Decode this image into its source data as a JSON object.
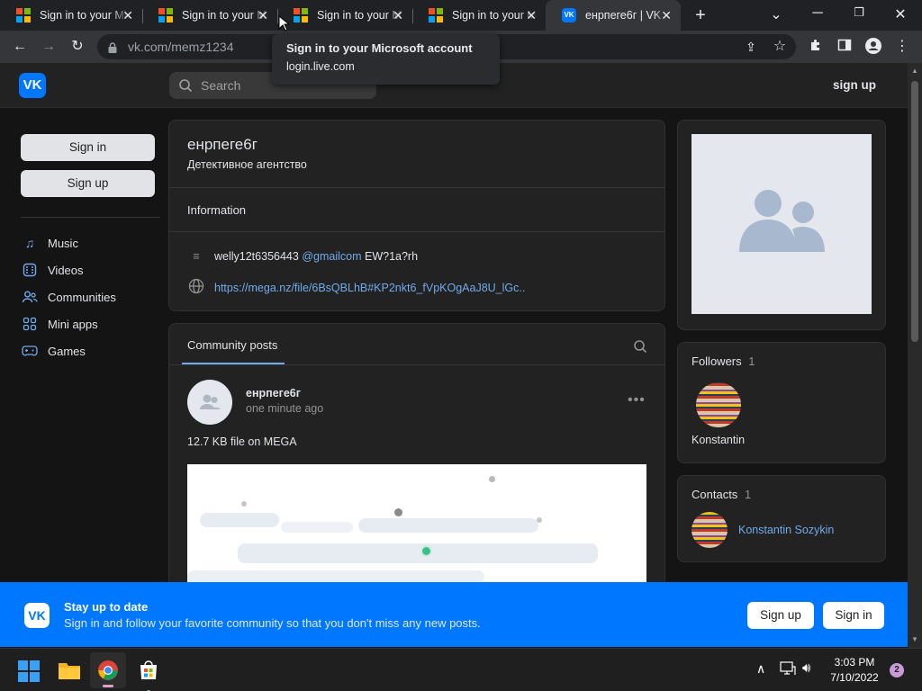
{
  "browser": {
    "tabs": [
      {
        "label": "Sign in to your Microsoft account"
      },
      {
        "label": "Sign in to your Microsoft account"
      },
      {
        "label": "Sign in to your Microsoft account"
      },
      {
        "label": "Sign in to your Microsoft account"
      },
      {
        "label": "енрпеге6г | VK"
      }
    ],
    "url": "vk.com/memz1234",
    "tooltip": {
      "title": "Sign in to your Microsoft account",
      "host": "login.live.com"
    }
  },
  "vk": {
    "search_placeholder": "Search",
    "header_signup": "sign up",
    "sign_in": "Sign in",
    "sign_up": "Sign up",
    "nav": [
      {
        "label": "Music",
        "icon": "music-icon"
      },
      {
        "label": "Videos",
        "icon": "videos-icon"
      },
      {
        "label": "Communities",
        "icon": "communities-icon"
      },
      {
        "label": "Mini apps",
        "icon": "mini-apps-icon"
      },
      {
        "label": "Games",
        "icon": "games-icon"
      }
    ],
    "profile": {
      "name": "енрпеге6г",
      "status": "Детективное агентство",
      "info_heading": "Information",
      "info_text_1": "welly12t6356443",
      "info_text_2": "@gmailcom",
      "info_text_3": "EW?1a?rh",
      "info_link": "https://mega.nz/file/6BsQBLhB#KP2nkt6_fVpKOgAaJ8U_lGc.."
    },
    "posts": {
      "tab_label": "Community posts",
      "author": "енрпеге6г",
      "time": "one minute ago",
      "text": "12.7 KB file on MEGA"
    },
    "followers": {
      "label": "Followers",
      "count": "1",
      "name": "Konstantin"
    },
    "contacts": {
      "label": "Contacts",
      "count": "1",
      "name": "Konstantin Sozykin"
    },
    "banner": {
      "title": "Stay up to date",
      "subtitle": "Sign in and follow your favorite community so that you don't miss any new posts.",
      "sign_up": "Sign up",
      "sign_in": "Sign in"
    }
  },
  "taskbar": {
    "time": "3:03 PM",
    "date": "7/10/2022",
    "notifications": "2"
  },
  "colors": {
    "vk_blue": "#0077ff",
    "link": "#71aaeb",
    "background": "#141414",
    "card": "#222222"
  }
}
